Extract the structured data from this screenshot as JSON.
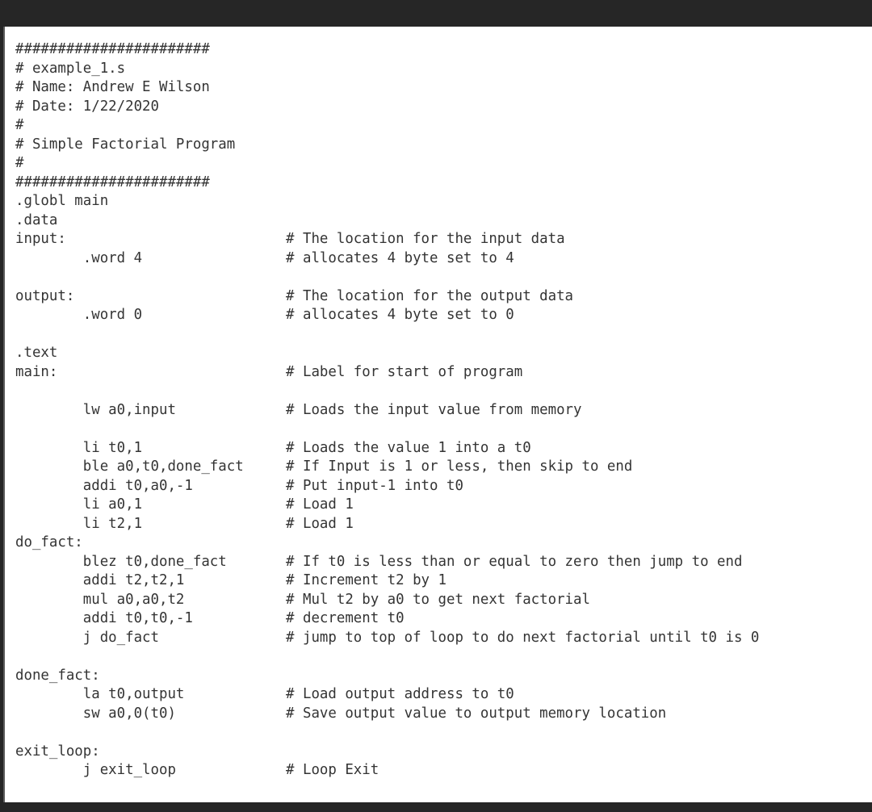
{
  "window": {
    "chrome_color": "#262626",
    "page_background": "#ffffff",
    "text_color": "#343434"
  },
  "document": {
    "language": "risc-v-assembly",
    "filename_in_header_comment": "example_1.s",
    "author_in_header_comment": "Andrew E Wilson",
    "date_in_header_comment": "1/22/2020",
    "description_in_header_comment": "Simple Factorial Program",
    "lines": [
      "#######################",
      "# example_1.s",
      "# Name: Andrew E Wilson",
      "# Date: 1/22/2020",
      "#",
      "# Simple Factorial Program",
      "#",
      "#######################",
      ".globl main",
      ".data",
      "input:                          # The location for the input data",
      "        .word 4                 # allocates 4 byte set to 4",
      "",
      "output:                         # The location for the output data",
      "        .word 0                 # allocates 4 byte set to 0",
      "",
      ".text",
      "main:                           # Label for start of program",
      "",
      "        lw a0,input             # Loads the input value from memory",
      "",
      "        li t0,1                 # Loads the value 1 into a t0",
      "        ble a0,t0,done_fact     # If Input is 1 or less, then skip to end",
      "        addi t0,a0,-1           # Put input-1 into t0",
      "        li a0,1                 # Load 1",
      "        li t2,1                 # Load 1",
      "do_fact:",
      "        blez t0,done_fact       # If t0 is less than or equal to zero then jump to end",
      "        addi t2,t2,1            # Increment t2 by 1",
      "        mul a0,a0,t2            # Mul t2 by a0 to get next factorial",
      "        addi t0,t0,-1           # decrement t0",
      "        j do_fact               # jump to top of loop to do next factorial until t0 is 0",
      "",
      "done_fact:",
      "        la t0,output            # Load output address to t0",
      "        sw a0,0(t0)             # Save output value to output memory location",
      "",
      "exit_loop:",
      "        j exit_loop             # Loop Exit"
    ]
  }
}
